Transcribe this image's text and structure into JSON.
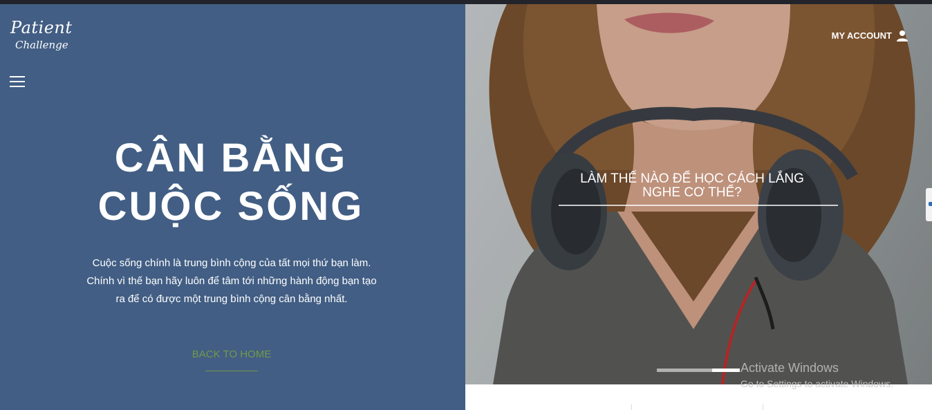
{
  "logo": {
    "line1": "Patient",
    "line2": "Challenge"
  },
  "menu": {
    "icon": "hamburger-menu-icon"
  },
  "hero": {
    "title_line1": "CÂN BẰNG",
    "title_line2": "CUỘC SỐNG",
    "description_line1": "Cuộc sống chính là trung bình cộng của tất mọi thứ bạn làm.",
    "description_line2": "Chính vì thế bạn hãy luôn để tâm tới những hành động bạn tạo",
    "description_line3": "ra để có được một trung bình cộng cân bằng nhất.",
    "back_home": "BACK TO HOME"
  },
  "account": {
    "label": "MY ACCOUNT",
    "icon": "user-icon"
  },
  "slide": {
    "caption_line1": "LÀM THẾ NÀO ĐỂ HỌC CÁCH LẮNG",
    "caption_line2": "NGHE CƠ THỂ?",
    "dot_count": 3,
    "active_dot": 3
  },
  "watermark": {
    "line1": "Activate Windows",
    "line2": "Go to Settings to activate Windows."
  },
  "colors": {
    "left_panel": "#425e84",
    "back_home": "#6f9a4a",
    "topbar": "#23242b"
  }
}
